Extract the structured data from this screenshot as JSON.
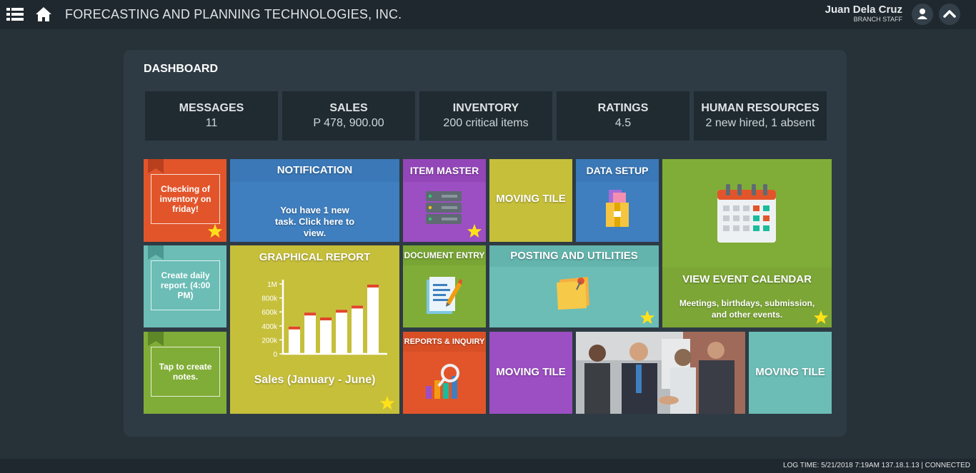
{
  "header": {
    "company": "FORECASTING AND PLANNING TECHNOLOGIES, INC.",
    "user_name": "Juan Dela Cruz",
    "user_role": "BRANCH STAFF"
  },
  "dashboard": {
    "title": "DASHBOARD",
    "stats": [
      {
        "label": "MESSAGES",
        "value": "11"
      },
      {
        "label": "SALES",
        "value": "P 478, 900.00"
      },
      {
        "label": "INVENTORY",
        "value": "200 critical items"
      },
      {
        "label": "RATINGS",
        "value": "4.5"
      },
      {
        "label": "HUMAN RESOURCES",
        "value": "2 new hired, 1 absent"
      }
    ]
  },
  "tiles": {
    "note1": "Checking of inventory on friday!",
    "note2": "Create daily report. (4:00 PM)",
    "note3": "Tap to create notes.",
    "notification_title": "NOTIFICATION",
    "notification_text": "You have 1 new task. Click here to view.",
    "graphical_title": "GRAPHICAL REPORT",
    "graphical_caption": "Sales (January - June)",
    "item_master": "ITEM MASTER",
    "moving_tile": "MOVING TILE",
    "data_setup": "DATA SETUP",
    "document_entry": "DOCUMENT ENTRY",
    "posting": "POSTING AND UTILITIES",
    "reports": "REPORTS & INQUIRY",
    "calendar_title": "VIEW EVENT CALENDAR",
    "calendar_text": "Meetings, birthdays, submission, and other events."
  },
  "chart_data": {
    "type": "bar",
    "title": "Sales (January - June)",
    "y_ticks": [
      "1M",
      "800k",
      "600k",
      "400k",
      "200k",
      "0"
    ],
    "ylim": [
      0,
      1000000
    ],
    "values": [
      380000,
      580000,
      510000,
      620000,
      680000,
      980000
    ],
    "colors": {
      "bar": "#ffffff",
      "cap": "#e0462a"
    }
  },
  "colors": {
    "orange": "#e2552b",
    "blue": "#3f7fbf",
    "purple": "#9b4fc2",
    "olive": "#c6bf3a",
    "teal": "#6bbdb6",
    "green": "#80ad37"
  },
  "status": {
    "text": "LOG TIME: 5/21/2018 7:19AM 137.18.1.13 | CONNECTED"
  }
}
